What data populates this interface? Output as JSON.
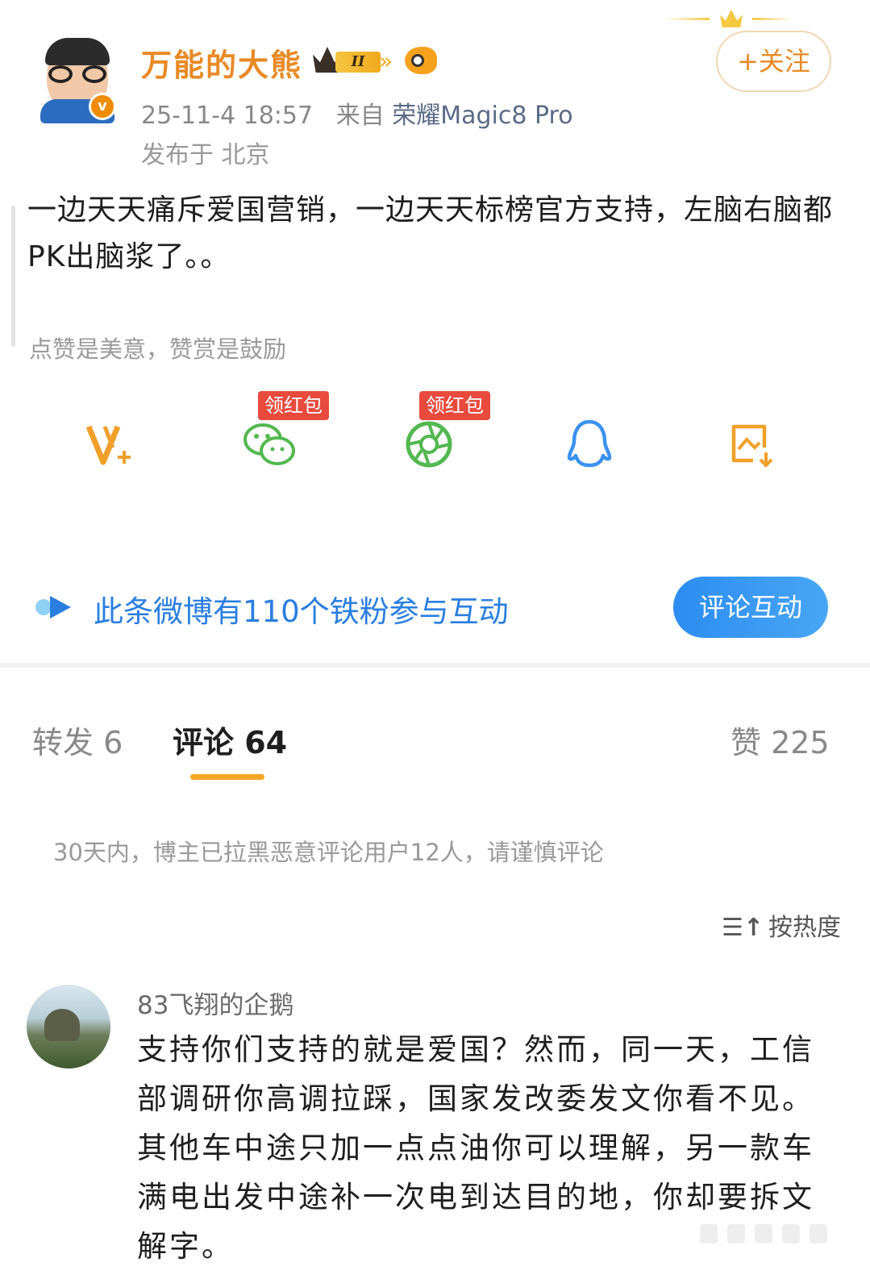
{
  "post": {
    "author": "万能的大熊",
    "vip_level": "II",
    "follow_label": "+关注",
    "timestamp": "25-11-4 18:57",
    "source_prefix": "来自",
    "device": "荣耀Magic8 Pro",
    "location": "发布于 北京",
    "body": "一边天天痛斥爱国营销，一边天天标榜官方支持，左脑右脑都PK出脑浆了。。",
    "tip": "点赞是美意，赞赏是鼓励"
  },
  "share": {
    "items": [
      {
        "icon": "v-plus-icon",
        "tag": ""
      },
      {
        "icon": "wechat-icon",
        "tag": "领红包"
      },
      {
        "icon": "moments-icon",
        "tag": "领红包"
      },
      {
        "icon": "qq-icon",
        "tag": ""
      },
      {
        "icon": "save-image-icon",
        "tag": ""
      }
    ]
  },
  "fans": {
    "text": "此条微博有110个铁粉参与互动",
    "button": "评论互动"
  },
  "tabs": {
    "repost": "转发 6",
    "comments": "评论 64",
    "likes": "赞 225"
  },
  "notice": "30天内，博主已拉黑恶意评论用户12人，请谨慎评论",
  "sort": {
    "icon": "sort-hot-icon",
    "label": "按热度"
  },
  "comment": {
    "user": "83飞翔的企鹅",
    "text": "支持你们支持的就是爱国？然而，同一天，工信部调研你高调拉踩，国家发改委发文你看不见。其他车中途只加一点点油你可以理解，另一款车满电出发中途补一次电到达目的地，你却要拆文解字。"
  },
  "colors": {
    "accent": "#e88a26",
    "link_blue": "#2a7ee0",
    "tab_underline": "#f5a623",
    "red_tag": "#e84a3e"
  }
}
